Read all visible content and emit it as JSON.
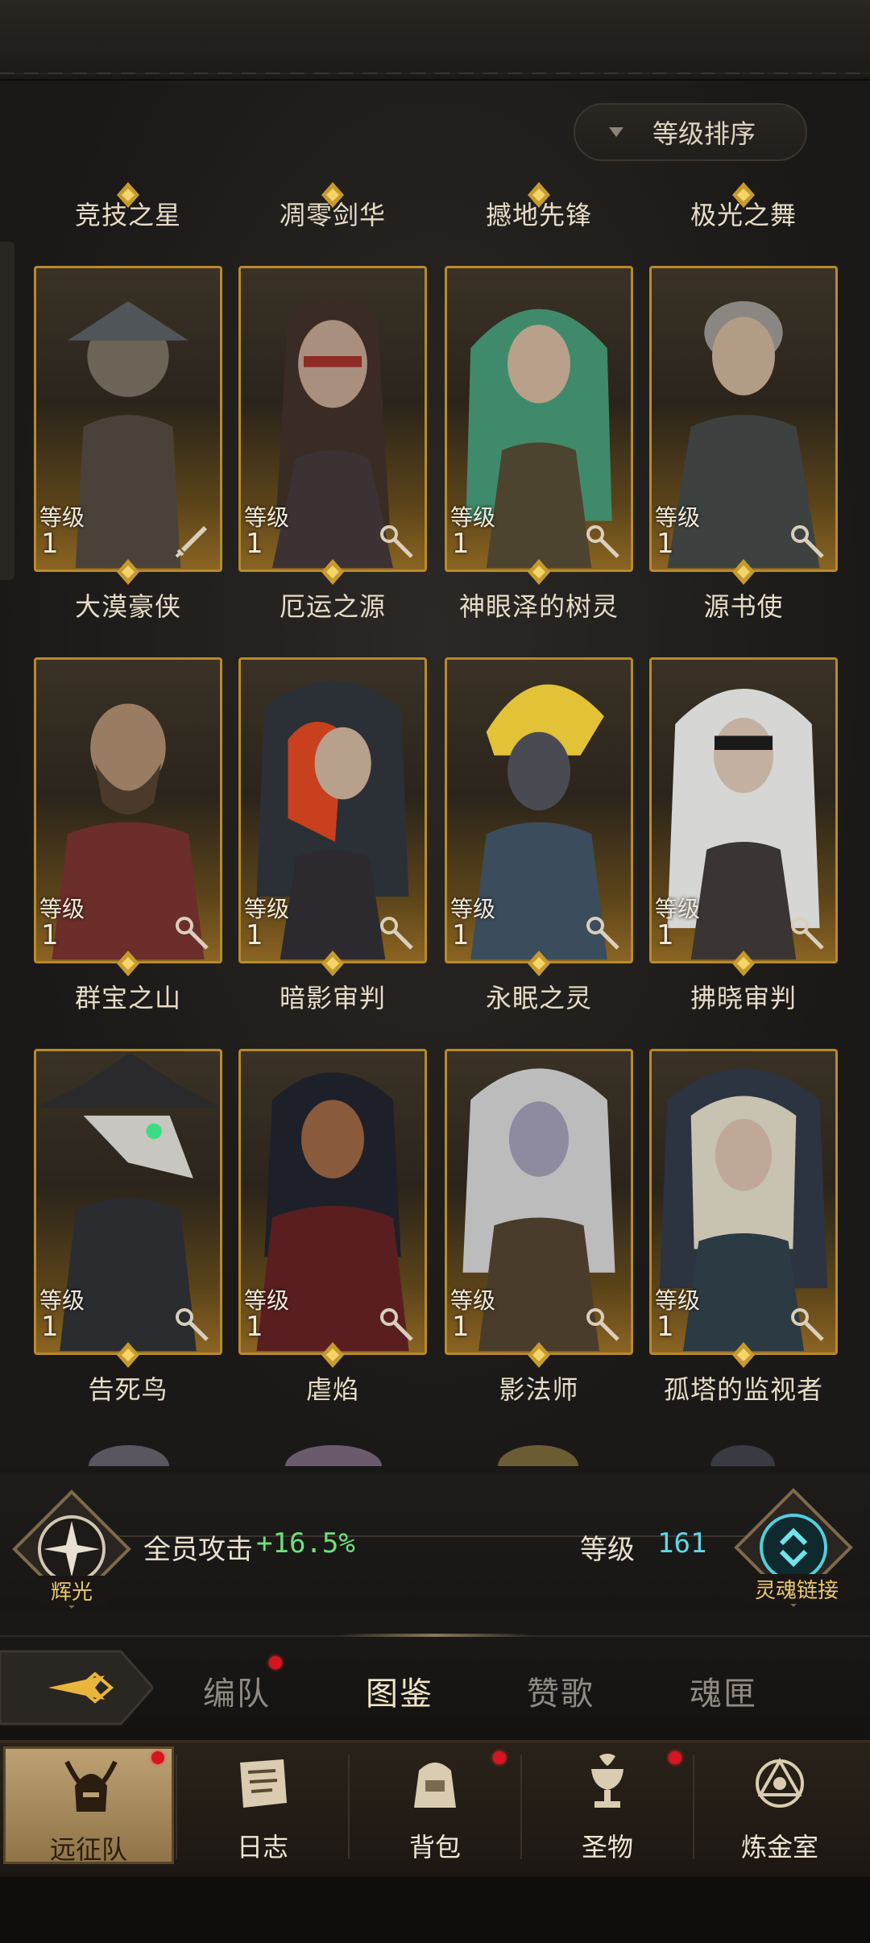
{
  "sort": {
    "label": "等级排序"
  },
  "hero_rows": [
    [
      {
        "name": "竞技之星",
        "level_label": "等级",
        "level": "1",
        "class": "sword-icon"
      },
      {
        "name": "凋零剑华",
        "level_label": "等级",
        "level": "1",
        "class": "wand-icon"
      },
      {
        "name": "撼地先锋",
        "level_label": "等级",
        "level": "1",
        "class": "wand-icon"
      },
      {
        "name": "极光之舞",
        "level_label": "等级",
        "level": "1",
        "class": "wand-icon"
      }
    ],
    [
      {
        "name": "大漠豪侠",
        "level_label": "等级",
        "level": "1",
        "class": "wand-icon"
      },
      {
        "name": "厄运之源",
        "level_label": "等级",
        "level": "1",
        "class": "wand-icon"
      },
      {
        "name": "神眼泽的树灵",
        "level_label": "等级",
        "level": "1",
        "class": "wand-icon"
      },
      {
        "name": "源书使",
        "level_label": "等级",
        "level": "1",
        "class": "wand-icon"
      }
    ],
    [
      {
        "name": "群宝之山",
        "level_label": "等级",
        "level": "1",
        "class": "wand-icon"
      },
      {
        "name": "暗影审判",
        "level_label": "等级",
        "level": "1",
        "class": "wand-icon"
      },
      {
        "name": "永眠之灵",
        "level_label": "等级",
        "level": "1",
        "class": "wand-icon"
      },
      {
        "name": "拂晓审判",
        "level_label": "等级",
        "level": "1",
        "class": "wand-icon"
      }
    ],
    [
      {
        "name": "告死鸟"
      },
      {
        "name": "虐焰"
      },
      {
        "name": "影法师"
      },
      {
        "name": "孤塔的监视者"
      }
    ]
  ],
  "bonus": {
    "emblem_label": "辉光",
    "text": "全员攻击",
    "value": "+16.5%",
    "level_label": "等级",
    "level_value": "161",
    "soul_link_label": "灵魂链接"
  },
  "tabs": [
    {
      "label": "编队",
      "badge": true
    },
    {
      "label": "图鉴",
      "active": true
    },
    {
      "label": "赞歌"
    },
    {
      "label": "魂匣"
    }
  ],
  "bottom_nav": [
    {
      "label": "远征队",
      "icon": "helmet-icon",
      "active": true,
      "badge": true
    },
    {
      "label": "日志",
      "icon": "scroll-icon"
    },
    {
      "label": "背包",
      "icon": "bag-icon",
      "badge": true
    },
    {
      "label": "圣物",
      "icon": "chalice-icon",
      "badge": true
    },
    {
      "label": "炼金室",
      "icon": "alchemy-icon"
    }
  ],
  "colors": {
    "gold_frame": "#b88a2a",
    "bonus_green": "#6fe07a",
    "level_cyan": "#5fd7e6",
    "badge_red": "#d8141e"
  }
}
